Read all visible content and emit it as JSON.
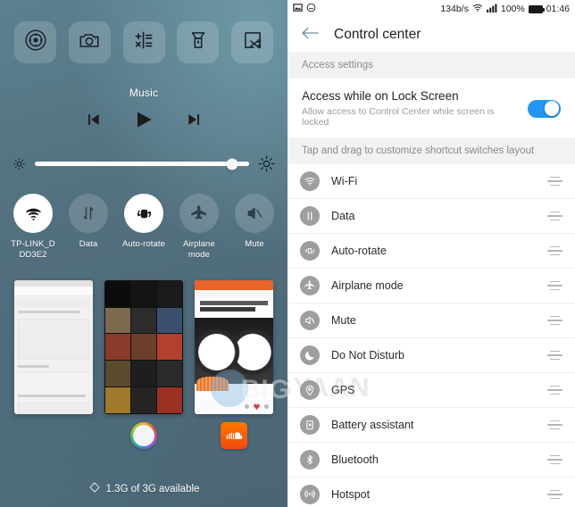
{
  "left_panel": {
    "shortcut_tiles": [
      {
        "name": "navigation-dock",
        "icon": "joystick-icon"
      },
      {
        "name": "camera",
        "icon": "camera-icon"
      },
      {
        "name": "calculator",
        "icon": "calculator-icon"
      },
      {
        "name": "flashlight",
        "icon": "flashlight-icon"
      },
      {
        "name": "screenshot",
        "icon": "screenshot-scissors-icon"
      }
    ],
    "music": {
      "label": "Music",
      "previous_icon": "skip-previous-icon",
      "play_icon": "play-icon",
      "next_icon": "skip-next-icon"
    },
    "brightness": {
      "low_icon": "brightness-low-icon",
      "high_icon": "brightness-high-icon",
      "value_percent": 92
    },
    "quick_toggles": [
      {
        "label": "TP-LINK_D DD3E2",
        "icon": "wifi-icon",
        "state": "on"
      },
      {
        "label": "Data",
        "icon": "data-arrows-icon",
        "state": "off"
      },
      {
        "label": "Auto-rotate",
        "icon": "auto-rotate-icon",
        "state": "on"
      },
      {
        "label": "Airplane mode",
        "icon": "airplane-icon",
        "state": "off"
      },
      {
        "label": "Mute",
        "icon": "mute-icon",
        "state": "off"
      }
    ],
    "recent_apps": [
      {
        "name": "news-article-card",
        "app_icon": "none"
      },
      {
        "name": "media-grid-card",
        "app_icon": "browser-ring-icon"
      },
      {
        "name": "music-player-card",
        "app_icon": "soundcloud-icon"
      }
    ],
    "memory_status": {
      "icon": "memory-diamond-icon",
      "text": "1.3G of 3G available"
    }
  },
  "right_panel": {
    "status_bar": {
      "left_icons": [
        "screenshot-icon",
        "face-icon"
      ],
      "network_speed": "134b/s",
      "wifi_icon": "wifi-icon",
      "signal_icon": "signal-bars-icon",
      "battery_percent": "100%",
      "battery_icon": "battery-full-icon",
      "time": "01:46"
    },
    "appbar": {
      "back_icon": "back-arrow-icon",
      "title": "Control center"
    },
    "access_settings_header": "Access settings",
    "lock_screen_row": {
      "title": "Access while on Lock Screen",
      "subtitle": "Allow access to Control Center while screen is locked",
      "toggle_state": "on",
      "toggle_color": "#2196f3"
    },
    "customize_header": "Tap and drag to customize shortcut switches layout",
    "switch_list": [
      {
        "label": "Wi-Fi",
        "icon": "wifi-icon"
      },
      {
        "label": "Data",
        "icon": "data-arrows-icon"
      },
      {
        "label": "Auto-rotate",
        "icon": "auto-rotate-icon"
      },
      {
        "label": "Airplane mode",
        "icon": "airplane-icon"
      },
      {
        "label": "Mute",
        "icon": "mute-icon"
      },
      {
        "label": "Do Not Disturb",
        "icon": "moon-icon"
      },
      {
        "label": "GPS",
        "icon": "location-pin-icon"
      },
      {
        "label": "Battery assistant",
        "icon": "battery-icon"
      },
      {
        "label": "Bluetooth",
        "icon": "bluetooth-icon"
      },
      {
        "label": "Hotspot",
        "icon": "hotspot-icon"
      }
    ],
    "drag_handle_icon": "drag-handle-icon"
  },
  "watermark": {
    "text_left": "BIG",
    "text_right": "GYAAN"
  }
}
